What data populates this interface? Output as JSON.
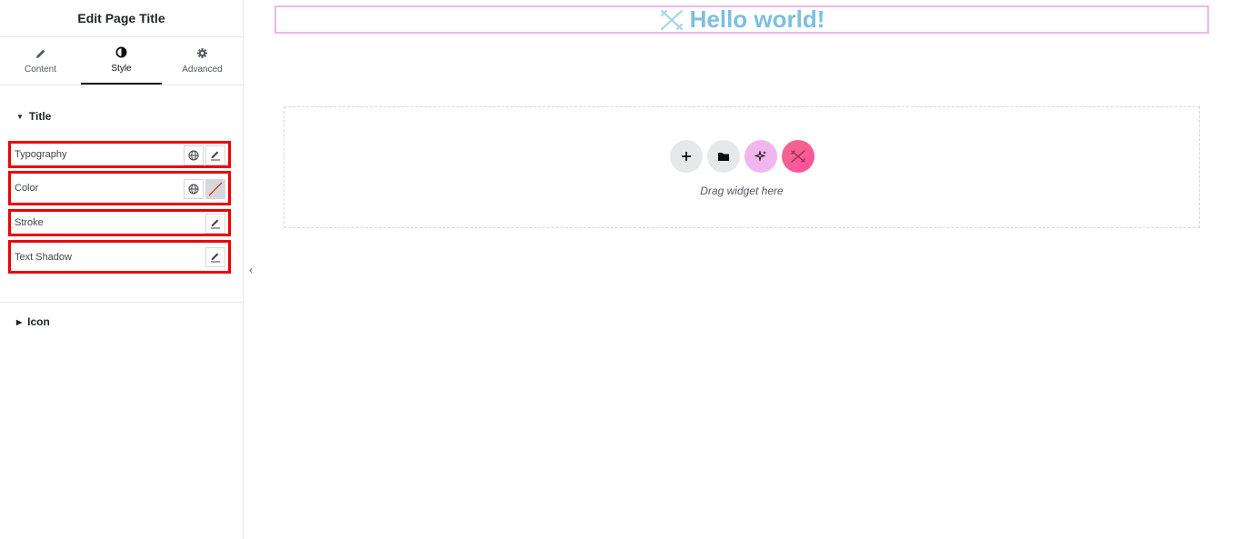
{
  "panel": {
    "title": "Edit Page Title",
    "tabs": [
      {
        "label": "Content",
        "icon": "pencil-icon"
      },
      {
        "label": "Style",
        "icon": "half-circle-icon"
      },
      {
        "label": "Advanced",
        "icon": "gear-icon"
      }
    ],
    "active_tab": "Style",
    "sections": [
      {
        "label": "Title",
        "expanded": true
      },
      {
        "label": "Icon",
        "expanded": false
      }
    ],
    "controls": [
      {
        "label": "Typography",
        "buttons": [
          "globe-icon",
          "edit-icon"
        ]
      },
      {
        "label": "Color",
        "buttons": [
          "globe-icon",
          "color-swatch"
        ]
      },
      {
        "label": "Stroke",
        "buttons": [
          "edit-icon"
        ]
      },
      {
        "label": "Text Shadow",
        "buttons": [
          "edit-icon"
        ]
      }
    ]
  },
  "canvas": {
    "heading": "Hello world!",
    "drop_text": "Drag widget here",
    "drop_buttons": [
      "plus-icon",
      "folder-icon",
      "sparkle-icon",
      "logo-icon"
    ]
  },
  "colors": {
    "highlight": "#e00000",
    "heading": "#7dbfe0",
    "heading_border": "#f0b6ee",
    "ai_button": "#f0b6ee",
    "brand_gradient_start": "#f06b8e",
    "brand_gradient_end": "#ff4f9a"
  }
}
